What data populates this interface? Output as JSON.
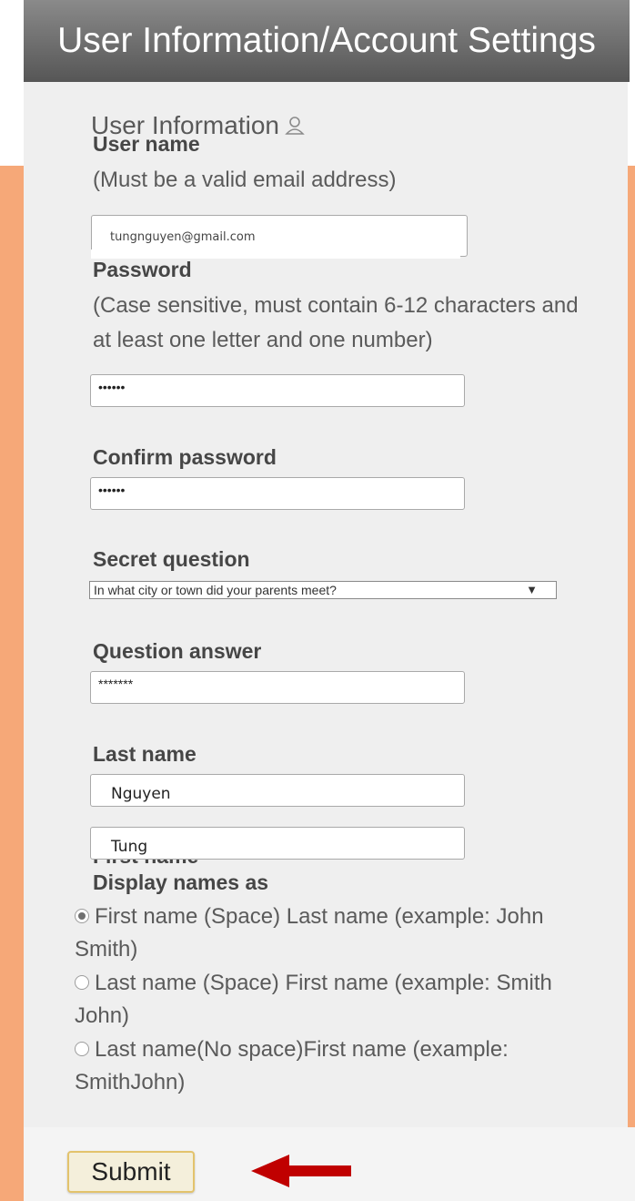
{
  "header": {
    "title": "User Information/Account Settings"
  },
  "section": {
    "title": "User Information",
    "icon": "user-icon"
  },
  "username": {
    "label": "User name",
    "hint": "(Must be a valid email address)",
    "value": "tungnguyen@gmail.com"
  },
  "password": {
    "label": "Password",
    "hint": "(Case sensitive, must contain 6-12 characters and at least one letter and one number)",
    "value": "••••••"
  },
  "confirm_password": {
    "label": "Confirm password",
    "value": "••••••"
  },
  "secret_question": {
    "label": "Secret question",
    "selected": "In what city or town did your parents meet?",
    "arrow": "▼"
  },
  "question_answer": {
    "label": "Question answer",
    "value": "*******"
  },
  "last_name": {
    "label": "Last name",
    "value": "Nguyen"
  },
  "first_name": {
    "label": "First name",
    "value": "Tung"
  },
  "display_names": {
    "label": "Display names as",
    "options": [
      {
        "label": "First name (Space) Last name (example: John Smith)",
        "selected": true
      },
      {
        "label": "Last name (Space) First name (example: Smith John)",
        "selected": false
      },
      {
        "label": "Last name(No space)First name (example: SmithJohn)",
        "selected": false
      }
    ]
  },
  "submit": {
    "label": "Submit"
  },
  "colors": {
    "background": "#f6a878",
    "panel": "#efefef",
    "header": "#6e6e6e",
    "annotation_arrow": "#c00000"
  }
}
